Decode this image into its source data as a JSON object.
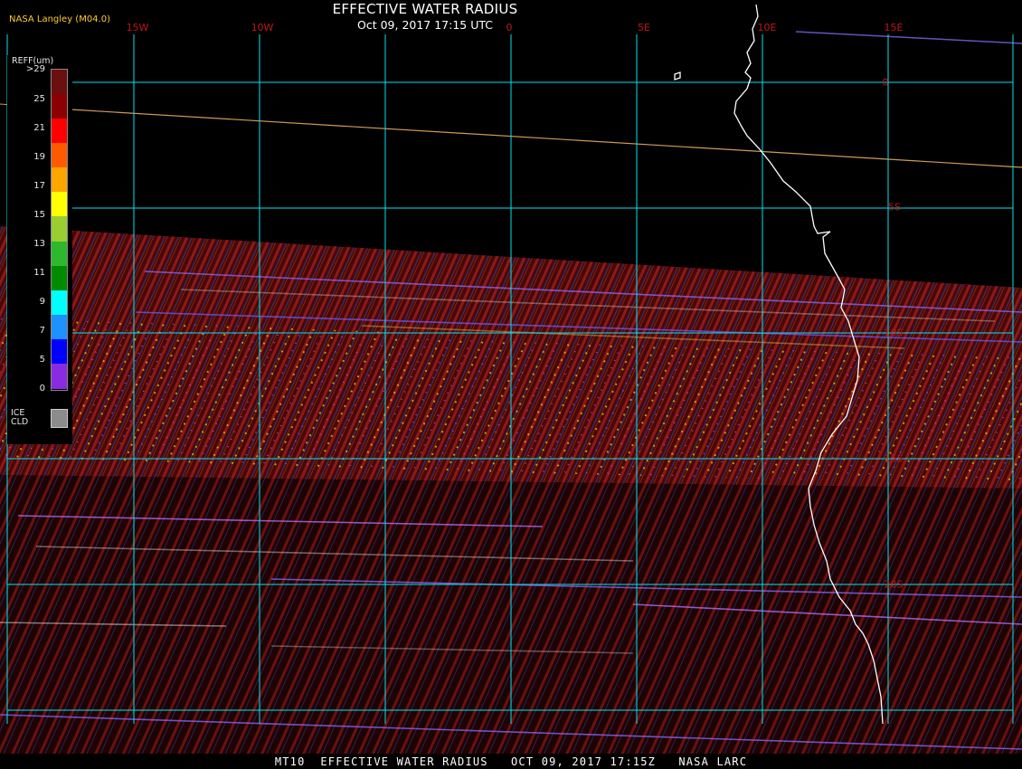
{
  "header": {
    "title": "EFFECTIVE WATER RADIUS",
    "datetime": "Oct 09, 2017 17:15 UTC",
    "producer": "NASA Langley (M04.0)"
  },
  "map": {
    "lon_labels": [
      "15W",
      "10W",
      "0",
      "5E",
      "10E",
      "15E"
    ],
    "lat_labels": [
      "0",
      "5S",
      "10S",
      "15S",
      "20S"
    ],
    "grid_color": "#00e5ee",
    "label_color": "#c01616",
    "coast_color": "#ffffff",
    "cloud_base_color": "#5a0a0a"
  },
  "legend": {
    "unit": "REFF(um)",
    "ticks": [
      ">29",
      "25",
      "21",
      "19",
      "17",
      "15",
      "13",
      "11",
      "9",
      "7",
      "5",
      "0"
    ],
    "colors": [
      "#6b0f0f",
      "#8b0000",
      "#ff0000",
      "#ff5a00",
      "#ffa500",
      "#ffff00",
      "#9acd32",
      "#2db82d",
      "#008b00",
      "#00ffff",
      "#1e90ff",
      "#0000ff",
      "#8a2be2"
    ],
    "ice_line1": "ICE",
    "ice_line2": "CLD",
    "ice_color": "#8c8c8c"
  },
  "footer": {
    "text": "MT10  EFFECTIVE WATER RADIUS   OCT 09, 2017 17:15Z   NASA LARC"
  }
}
